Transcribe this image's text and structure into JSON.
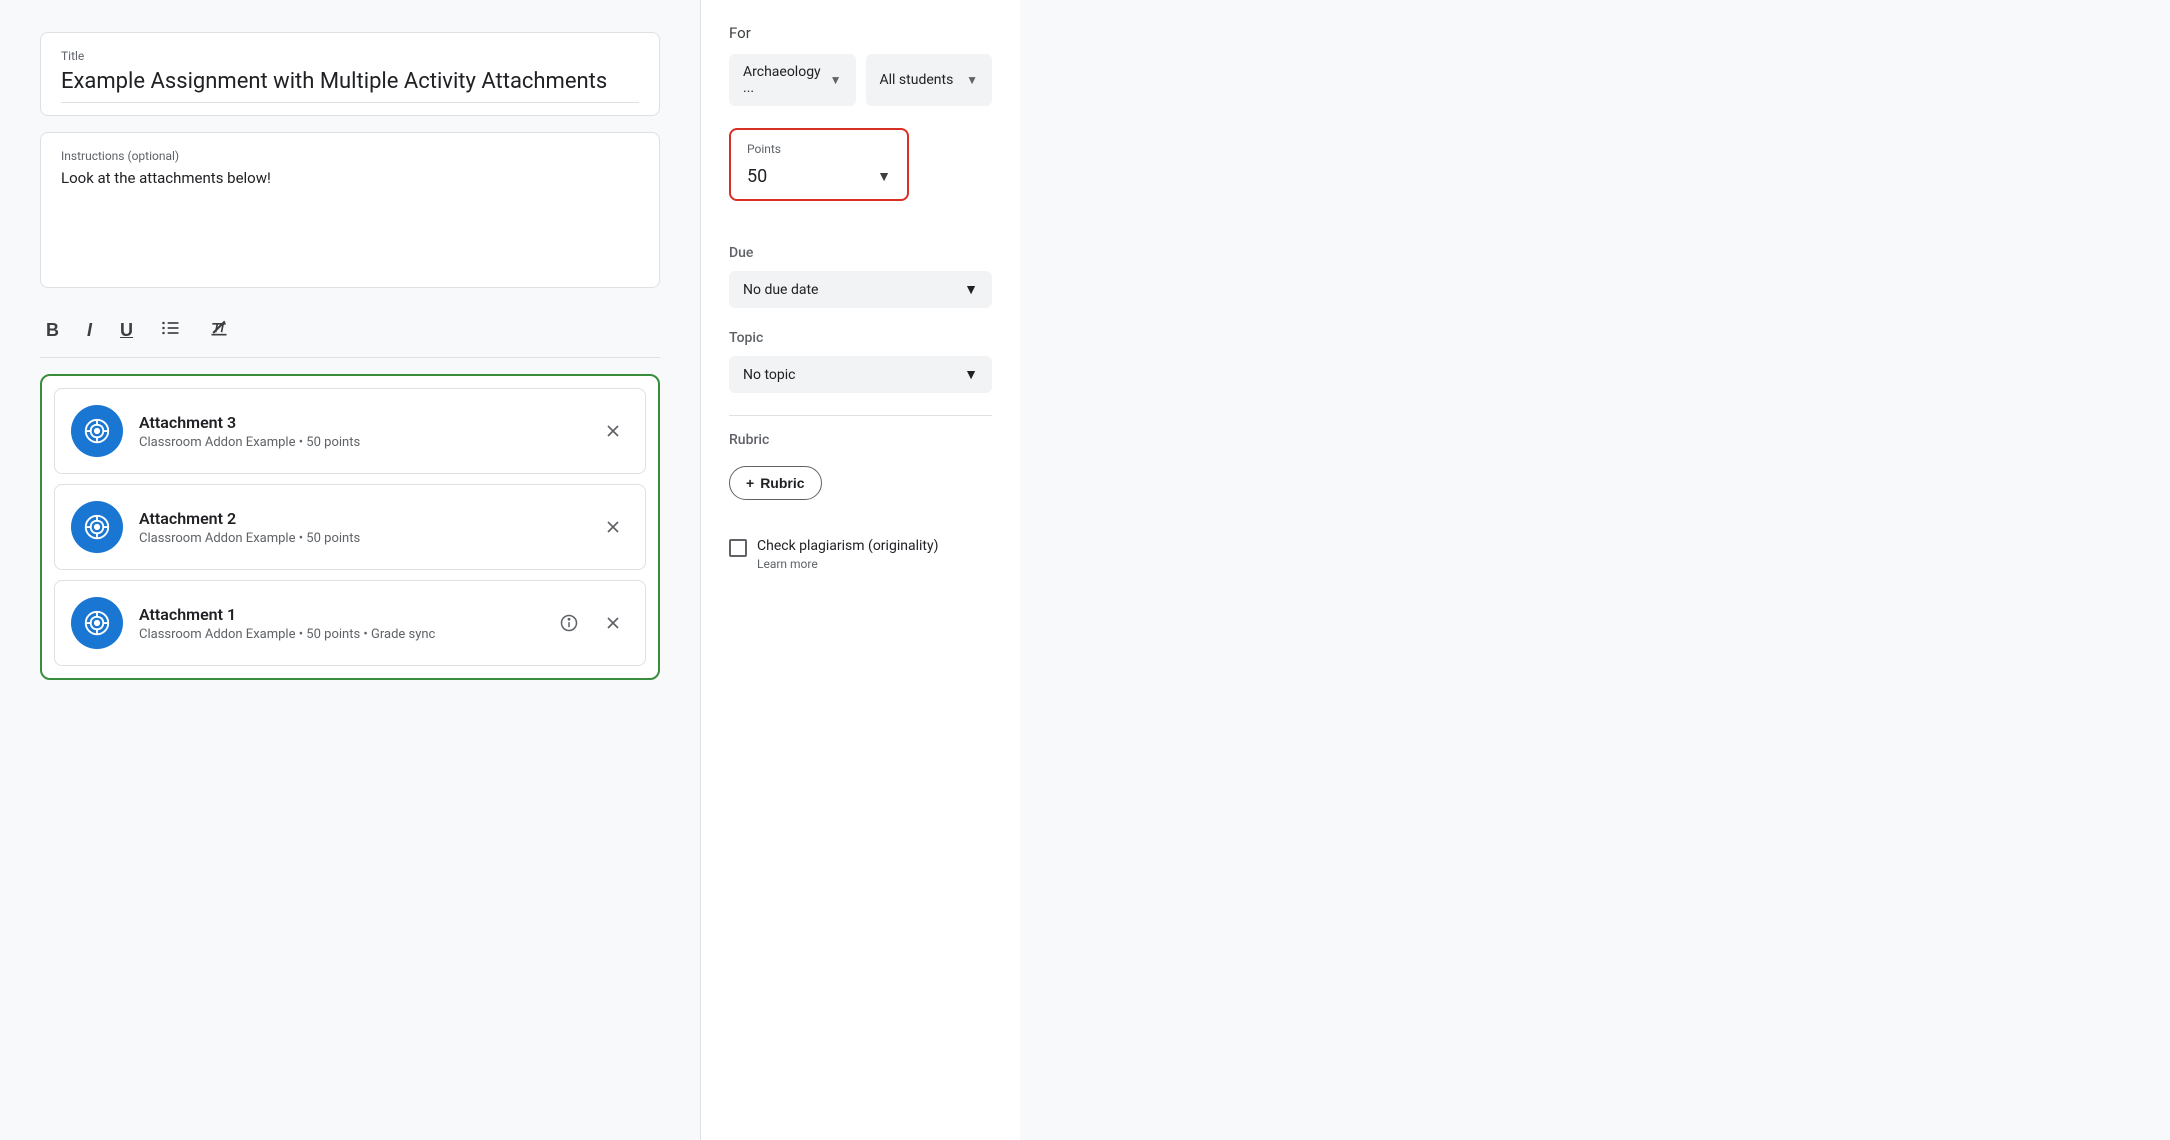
{
  "title_section": {
    "label": "Title",
    "value": "Example Assignment with Multiple Activity Attachments"
  },
  "instructions_section": {
    "label": "Instructions (optional)",
    "value": "Look at the attachments below!"
  },
  "toolbar": {
    "bold": "B",
    "italic": "I",
    "underline": "U",
    "list": "≡",
    "clear_format": "✕"
  },
  "attachments": [
    {
      "name": "Attachment 3",
      "meta": "Classroom Addon Example • 50 points",
      "has_info": false
    },
    {
      "name": "Attachment 2",
      "meta": "Classroom Addon Example • 50 points",
      "has_info": false
    },
    {
      "name": "Attachment 1",
      "meta": "Classroom Addon Example • 50 points • Grade sync",
      "has_info": true
    }
  ],
  "sidebar": {
    "for_label": "For",
    "class_dropdown": "Archaeology ...",
    "students_dropdown": "All students",
    "points_label": "Points",
    "points_value": "50",
    "due_label": "Due",
    "due_value": "No due date",
    "topic_label": "Topic",
    "topic_value": "No topic",
    "rubric_label": "Rubric",
    "rubric_btn_label": "+ Rubric",
    "plagiarism_label": "Check plagiarism (originality)",
    "learn_more": "Learn more"
  }
}
